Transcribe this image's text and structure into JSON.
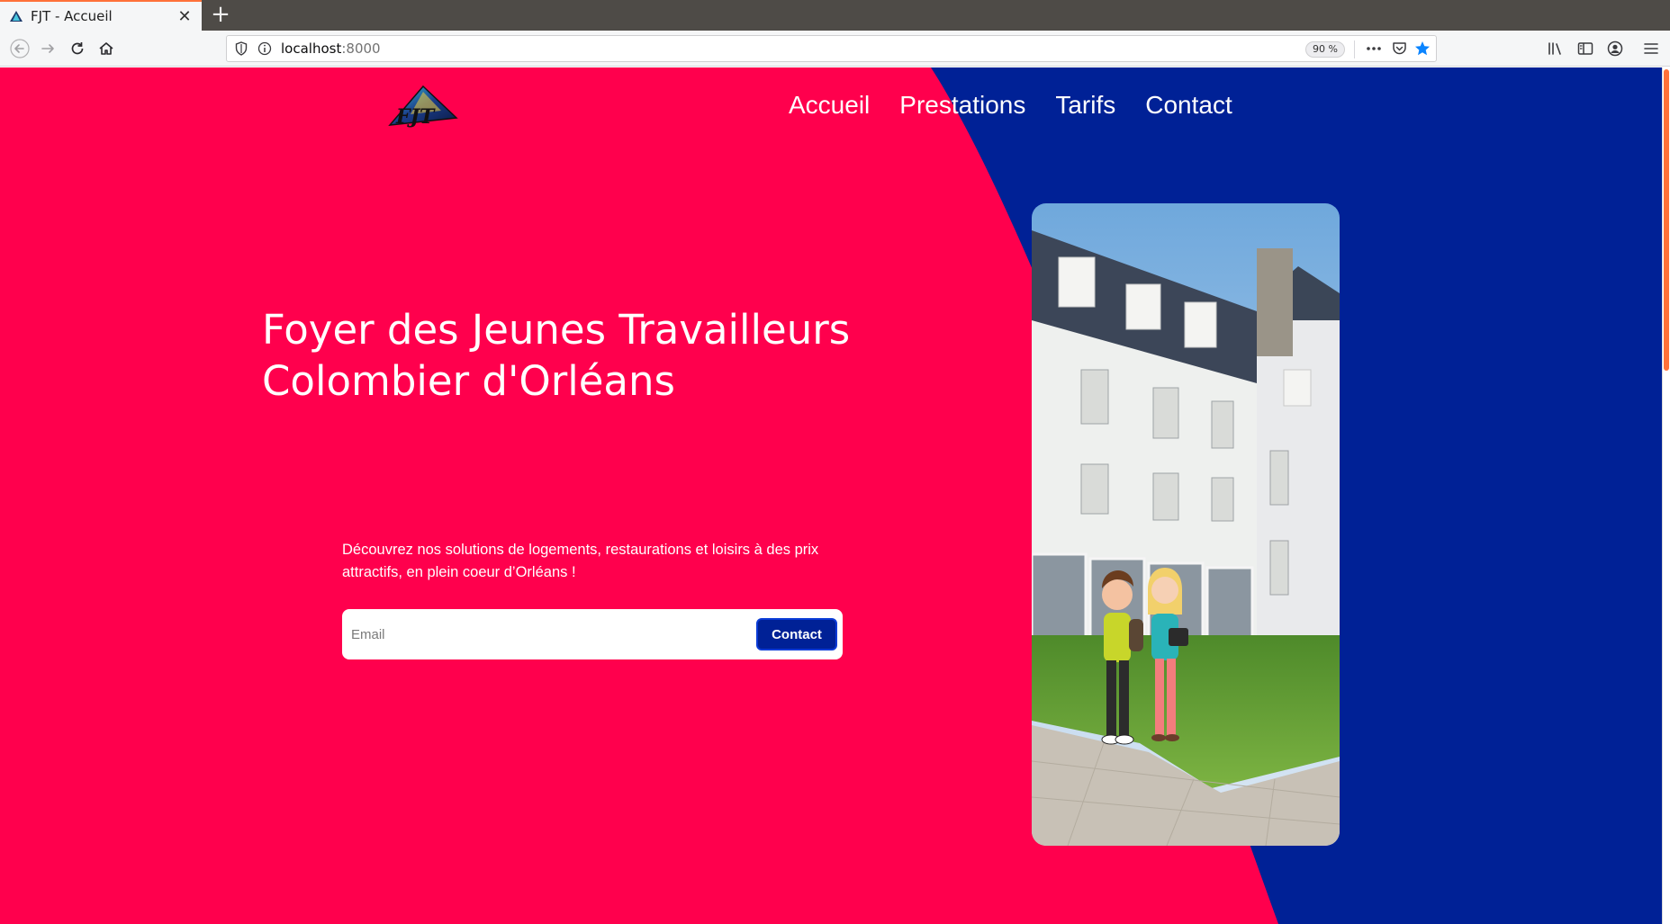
{
  "browser": {
    "tab_title": "FJT - Accueil",
    "url_host": "localhost",
    "url_port": ":8000",
    "zoom": "90 %"
  },
  "site": {
    "nav": [
      "Accueil",
      "Prestations",
      "Tarifs",
      "Contact"
    ],
    "logo_text": "FJT",
    "hero_title_line1": "Foyer des Jeunes Travailleurs",
    "hero_title_line2": "Colombier d'Orléans",
    "hero_text": "Découvrez nos solutions de logements, restaurations et loisirs à des prix attractifs, en plein coeur d’Orléans !",
    "email_placeholder": "Email",
    "contact_button": "Contact"
  },
  "colors": {
    "primary_pink": "#ff004d",
    "secondary_blue": "#002196",
    "text_white": "#ffffff"
  },
  "icons": [
    "back-arrow-icon",
    "forward-arrow-icon",
    "reload-icon",
    "home-icon",
    "shield-icon",
    "info-icon",
    "more-icon",
    "pocket-icon",
    "bookmark-star-icon",
    "library-icon",
    "sidebar-icon",
    "account-icon",
    "hamburger-menu-icon"
  ]
}
